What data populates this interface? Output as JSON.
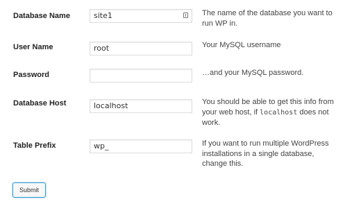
{
  "form": {
    "rows": [
      {
        "label": "Database Name",
        "value": "site1",
        "description": "The name of the database you want to run WP in."
      },
      {
        "label": "User Name",
        "value": "root",
        "description": "Your MySQL username"
      },
      {
        "label": "Password",
        "value": "",
        "description": "…and your MySQL password."
      },
      {
        "label": "Database Host",
        "value": "localhost",
        "description_before": "You should be able to get this info from your web host, if ",
        "description_code": "localhost",
        "description_after": " does not work."
      },
      {
        "label": "Table Prefix",
        "value": "wp_",
        "description": "If you want to run multiple WordPress installations in a single database, change this."
      }
    ],
    "submit_label": "Submit"
  }
}
